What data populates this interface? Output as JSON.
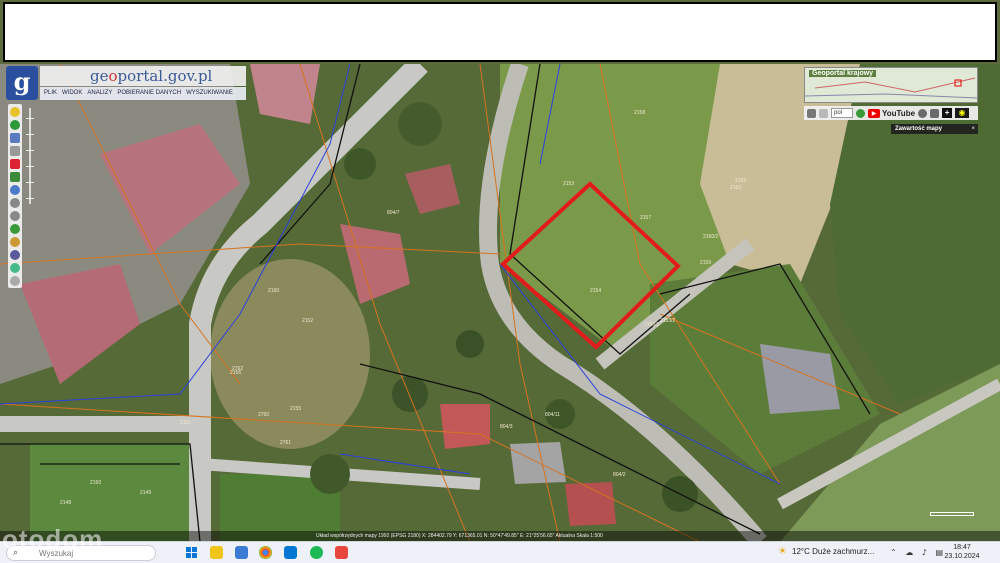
{
  "header": {
    "logo_letter": "g",
    "site_name": "geoportal.gov.pl",
    "site_name_prefix": "ge",
    "site_name_accent": "o",
    "site_name_suffix": "portal.gov.pl",
    "menu": [
      "PLIK",
      "WIDOK",
      "ANALIZY",
      "POBIERANIE DANYCH",
      "WYSZUKIWANIE"
    ]
  },
  "overview": {
    "title": "Geoportal krajowy"
  },
  "right_toolbar": {
    "select_value": "pol",
    "youtube_label": "YouTube",
    "plus_label": "+"
  },
  "map_contents": {
    "label": "Zawartość mapy",
    "close": "×"
  },
  "map": {
    "parcel_labels": [
      "2153",
      "2157",
      "2163",
      "2158",
      "2159",
      "2154",
      "2160",
      "2155",
      "2156",
      "2152",
      "2151",
      "2150",
      "2149",
      "2148",
      "2193",
      "2160/2",
      "2153/1",
      "2153/2",
      "804/7",
      "804/2",
      "804/11",
      "804/3",
      "2762",
      "2760",
      "2761"
    ],
    "highlight_color": "#e21b1b"
  },
  "statusbar": {
    "text": "Układ współrzędnych mapy 1992 (EPSG 2180)   X: 284402.79  Y: 671365.01   N: 50°47'49.85\"  E: 21°25'56.65\"   Aktualna Skala 1:500"
  },
  "taskbar": {
    "search_placeholder": "Wyszukaj",
    "weather_temp": "12°C",
    "weather_desc": "Duże zachmurz...",
    "time": "18:47",
    "date": "23.10.2024"
  },
  "watermark": "otodom"
}
